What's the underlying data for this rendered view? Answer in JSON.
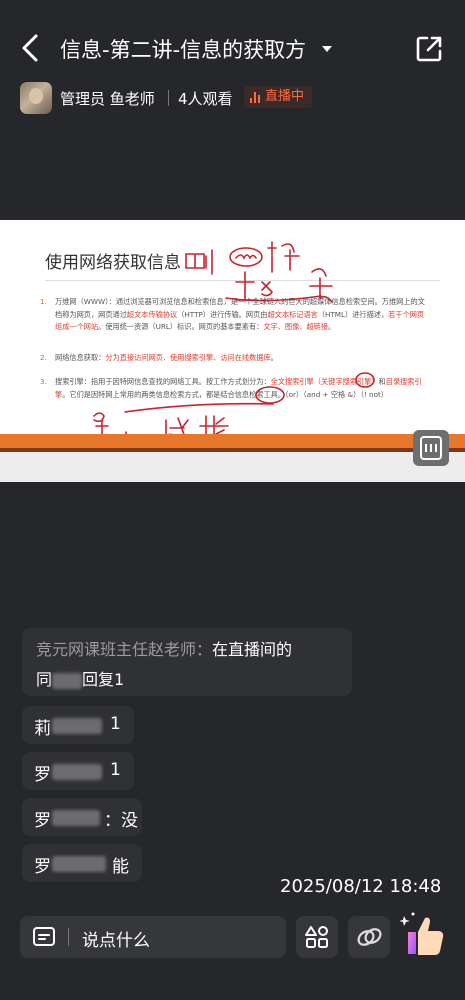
{
  "header": {
    "title": "信息-第二讲-信息的获取方",
    "back_icon": "chevron-left-icon",
    "dropdown_icon": "caret-down-icon",
    "share_icon": "share-icon"
  },
  "host": {
    "name": "管理员 鱼老师",
    "viewers": "4人观看",
    "live_badge": "直播中",
    "live_color": "#ff6a3d"
  },
  "slide": {
    "title": "使用网络获取信息",
    "items": [
      {
        "num": "1.",
        "text_a": "万维网（WWW）：通过浏览器可浏览信息和检索信息，是一个全球链入的巨大的超媒体信息检索空间。万维网上的文档称为网页，网页通过",
        "red_a": "超文本传输协议",
        "text_b": "（HTTP）进行传输。网页由",
        "red_b": "超文本标记语言",
        "text_c": "（HTML）进行描述，",
        "red_c": "若干个网页组成一个网站",
        "text_d": "。使用统一资源（URL）标识。网页的基本要素有：",
        "red_d": "文字、图像、超链接",
        "text_e": "。"
      },
      {
        "num": "2.",
        "text_a": "网络信息获取：",
        "red_a": "分为直接访问网页、使用搜索引擎、访问在线数据库",
        "text_b": "。"
      },
      {
        "num": "3.",
        "text_a": "搜索引擎：指用于因特网信息查找的网络工具。按工作方式划分为：",
        "red_a": "全文搜索引擎（关键字搜索引擎）",
        "text_b": "和",
        "red_b": "目录搜索引擎",
        "text_c": "。它们是因特网上常用的两类信息检索方式，都是结合信息检索工具。（or）（and + 空格 &）（! not）"
      }
    ],
    "ink_annotations": [
      "则",
      "and",
      "方解",
      "主",
      "目录",
      "与",
      "或",
      "非",
      "and"
    ],
    "ocr_icon": "text-recognize-icon",
    "accent": "#e8772c"
  },
  "chat": {
    "teacher_name": "竞元网课班主任赵老师：",
    "teacher_msg": "在直播间的",
    "teacher_msg2a": "同",
    "teacher_msg2b": "回复1",
    "messages": [
      {
        "prefix": "莉",
        "text": "1"
      },
      {
        "prefix": "罗",
        "text": "1"
      },
      {
        "prefix": "罗",
        "text": "：没"
      },
      {
        "prefix": "罗",
        "text": "能"
      }
    ]
  },
  "timestamp": "2025/08/12 18:48",
  "footer": {
    "placeholder": "说点什么",
    "input_icon": "comment-edit-icon",
    "apps_icon": "apps-grid-icon",
    "gift_icon": "link-loop-icon",
    "like_icon": "thumbs-up-icon"
  }
}
